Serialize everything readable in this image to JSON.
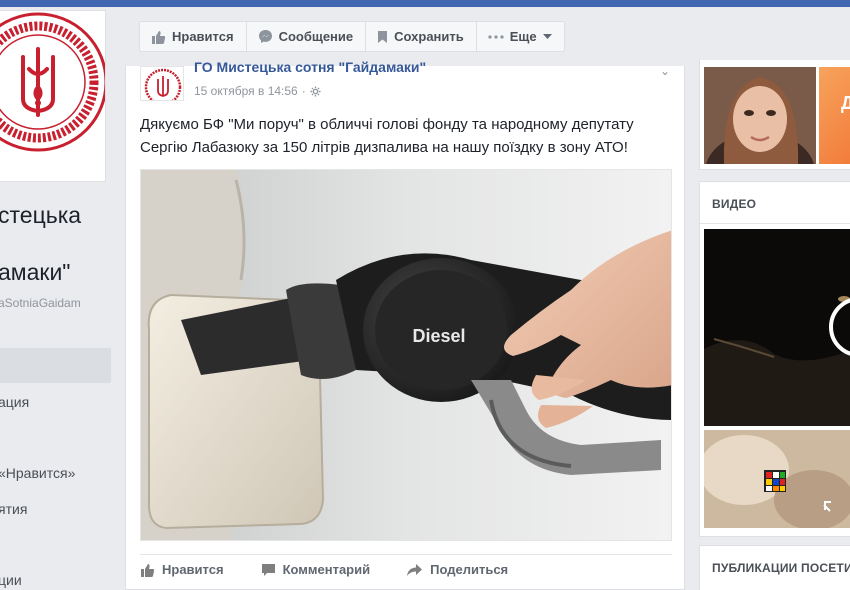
{
  "page": {
    "name_line1": "стецька",
    "name_line2": "амаки\"",
    "handle": "aSotniaGaidam",
    "emblem_text": "ГАЙДАМАКИ"
  },
  "nav": {
    "items": [
      "ация",
      "«Нравится»",
      "ятия",
      "ции"
    ]
  },
  "actions": {
    "like": "Нравится",
    "message": "Сообщение",
    "save": "Сохранить",
    "more": "Еще"
  },
  "post": {
    "author": "ГО Мистецька сотня \"Гайдамаки\"",
    "date": "15 октября в 14:56",
    "text": "Дякуємо БФ \"Ми поруч\" в обличчі голові фонду та народному депутату Сергію Лабазюку за 150 літрів дизпалива на нашу поїздку в зону АТО!",
    "image_label": "Diesel",
    "actions": {
      "like": "Нравится",
      "comment": "Комментарий",
      "share": "Поделиться"
    }
  },
  "right": {
    "video_title": "ВИДЕО",
    "publications_title": "ПУБЛИКАЦИИ ПОСЕТИ",
    "photo2_letter": "Д"
  },
  "colors": {
    "fb_blue": "#4267b2",
    "link_blue": "#365899",
    "emblem_red": "#c8202f"
  }
}
